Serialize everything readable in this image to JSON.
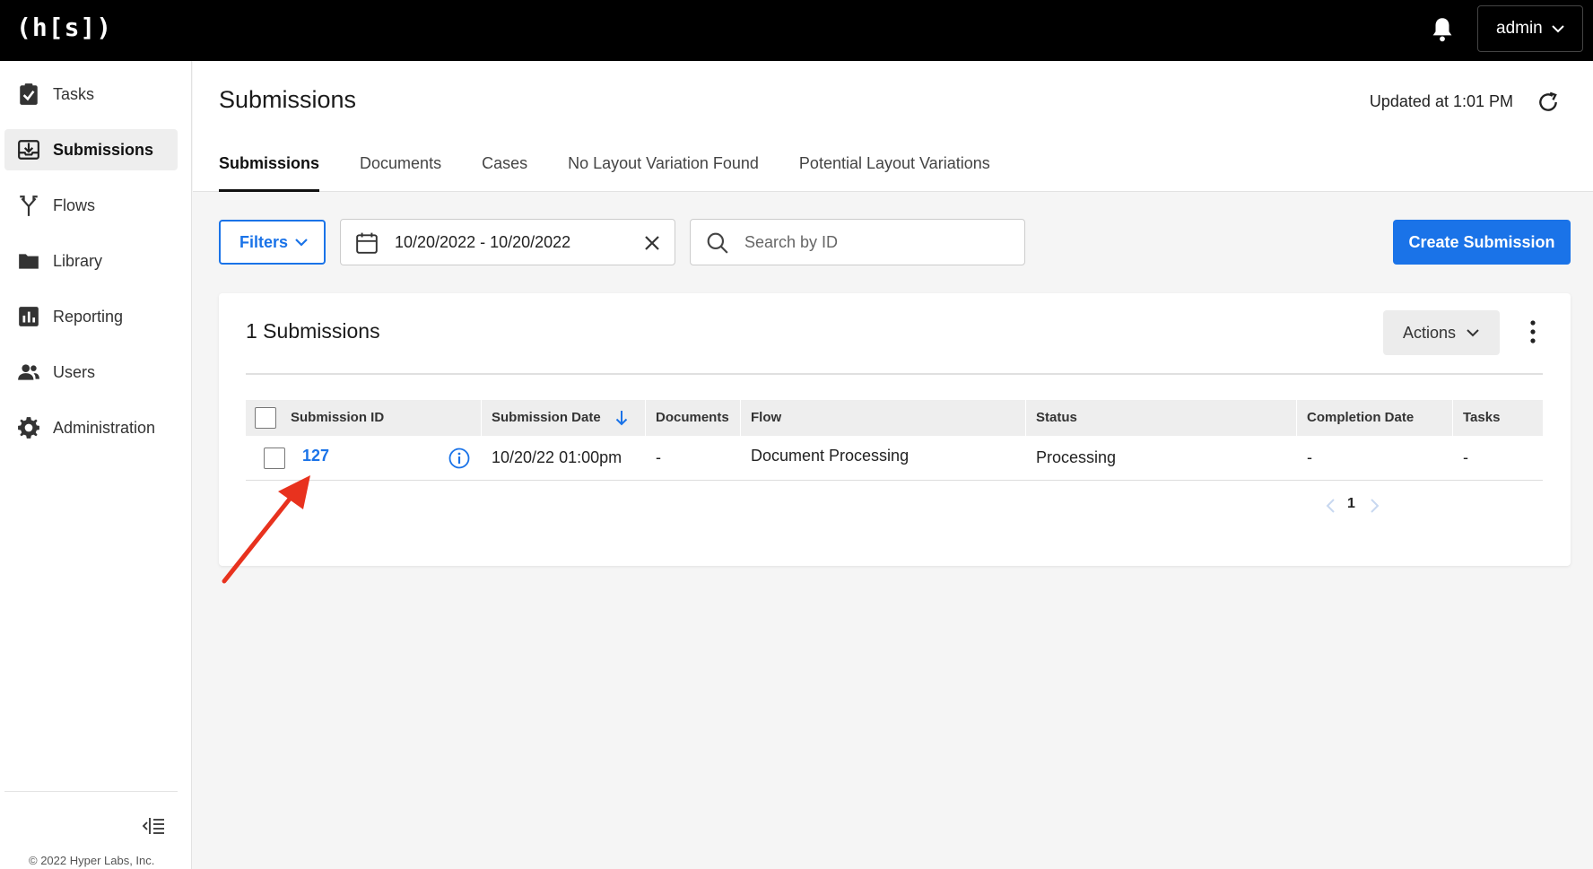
{
  "app": {
    "logo": "(h[s])",
    "user": "admin"
  },
  "sidebar": {
    "items": [
      {
        "label": "Tasks",
        "icon": "clipboard-check-icon"
      },
      {
        "label": "Submissions",
        "icon": "tray-download-icon",
        "active": true
      },
      {
        "label": "Flows",
        "icon": "branch-icon"
      },
      {
        "label": "Library",
        "icon": "folder-icon"
      },
      {
        "label": "Reporting",
        "icon": "bar-chart-icon"
      },
      {
        "label": "Users",
        "icon": "users-icon"
      },
      {
        "label": "Administration",
        "icon": "gear-icon"
      }
    ],
    "copyright": "© 2022 Hyper Labs, Inc."
  },
  "header": {
    "title": "Submissions",
    "updated": "Updated at 1:01 PM",
    "tabs": [
      {
        "label": "Submissions",
        "active": true
      },
      {
        "label": "Documents"
      },
      {
        "label": "Cases"
      },
      {
        "label": "No Layout Variation Found"
      },
      {
        "label": "Potential Layout Variations"
      }
    ]
  },
  "toolbar": {
    "filters_label": "Filters",
    "date_range": "10/20/2022 - 10/20/2022",
    "search_placeholder": "Search by ID",
    "create_label": "Create Submission"
  },
  "card": {
    "title": "1 Submissions",
    "actions_label": "Actions",
    "columns": [
      "Submission ID",
      "Submission Date",
      "Documents",
      "Flow",
      "Status",
      "Completion Date",
      "Tasks"
    ],
    "rows": [
      {
        "id": "127",
        "date": "10/20/22 01:00pm",
        "documents": "-",
        "flow": "Document Processing",
        "status": "Processing",
        "completion": "-",
        "tasks": "-"
      }
    ],
    "page": "1"
  },
  "colors": {
    "accent": "#1a73e8",
    "topbar": "#000000",
    "annotation_arrow": "#e8321e"
  }
}
